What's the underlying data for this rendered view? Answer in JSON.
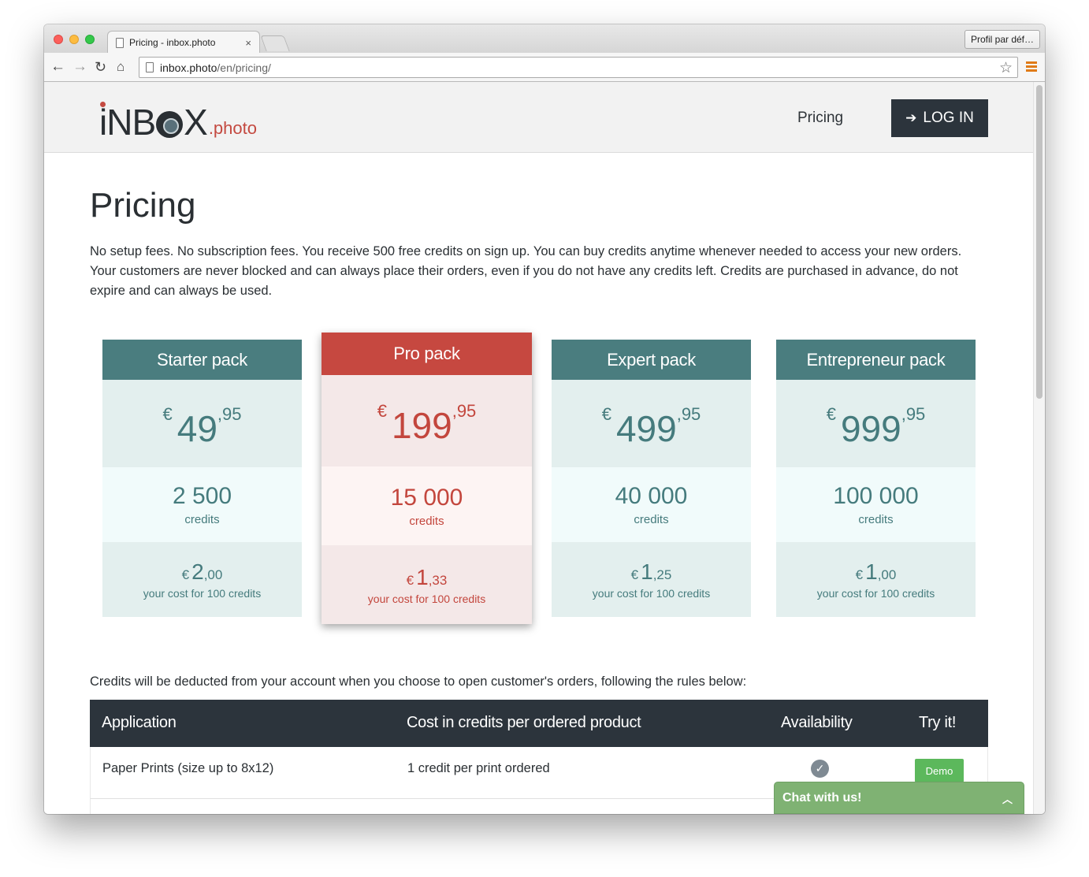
{
  "browser": {
    "tab_title": "Pricing - inbox.photo",
    "tab_close": "×",
    "profile_button": "Profil par déf…",
    "url_host": "inbox.photo",
    "url_path": "/en/pricing/",
    "icons": [
      "back-icon",
      "forward-icon",
      "reload-icon",
      "home-icon",
      "bookmark-star-icon",
      "menu-icon"
    ]
  },
  "header": {
    "logo_main_1": "iNB",
    "logo_main_2": "X",
    "logo_suffix": ".photo",
    "nav_pricing": "Pricing",
    "login_label": "LOG IN",
    "brand_color": "#c44a41",
    "login_bg": "#2c343c"
  },
  "page": {
    "title": "Pricing",
    "intro": "No setup fees. No subscription fees. You receive 500 free credits on sign up. You can buy credits anytime whenever needed to access your new orders. Your customers are never blocked and can always place their orders, even if you do not have any credits left. Credits are purchased in advance, do not expire and can always be used.",
    "rules_intro": "Credits will be deducted from your account when you choose to open customer's orders, following the rules below:"
  },
  "packs": [
    {
      "name": "Starter pack",
      "currency": "€",
      "price_int": "49",
      "price_cents": ",95",
      "credits": "2 500",
      "credits_label": "credits",
      "cost_int": "2",
      "cost_cents": ",00",
      "cost_label": "your cost for 100 credits"
    },
    {
      "name": "Pro pack",
      "currency": "€",
      "price_int": "199",
      "price_cents": ",95",
      "credits": "15 000",
      "credits_label": "credits",
      "cost_int": "1",
      "cost_cents": ",33",
      "cost_label": "your cost for 100 credits"
    },
    {
      "name": "Expert pack",
      "currency": "€",
      "price_int": "499",
      "price_cents": ",95",
      "credits": "40 000",
      "credits_label": "credits",
      "cost_int": "1",
      "cost_cents": ",25",
      "cost_label": "your cost for 100 credits"
    },
    {
      "name": "Entrepreneur pack",
      "currency": "€",
      "price_int": "999",
      "price_cents": ",95",
      "credits": "100 000",
      "credits_label": "credits",
      "cost_int": "1",
      "cost_cents": ",00",
      "cost_label": "your cost for 100 credits"
    }
  ],
  "table": {
    "headers": [
      "Application",
      "Cost in credits per ordered product",
      "Availability",
      "Try it!"
    ],
    "rows": [
      {
        "application": "Paper Prints (size up to 8x12)",
        "cost": "1 credit per print ordered",
        "available": true,
        "try_label": "Demo"
      }
    ]
  },
  "chat": {
    "label": "Chat with us!",
    "color": "#7fb273"
  }
}
